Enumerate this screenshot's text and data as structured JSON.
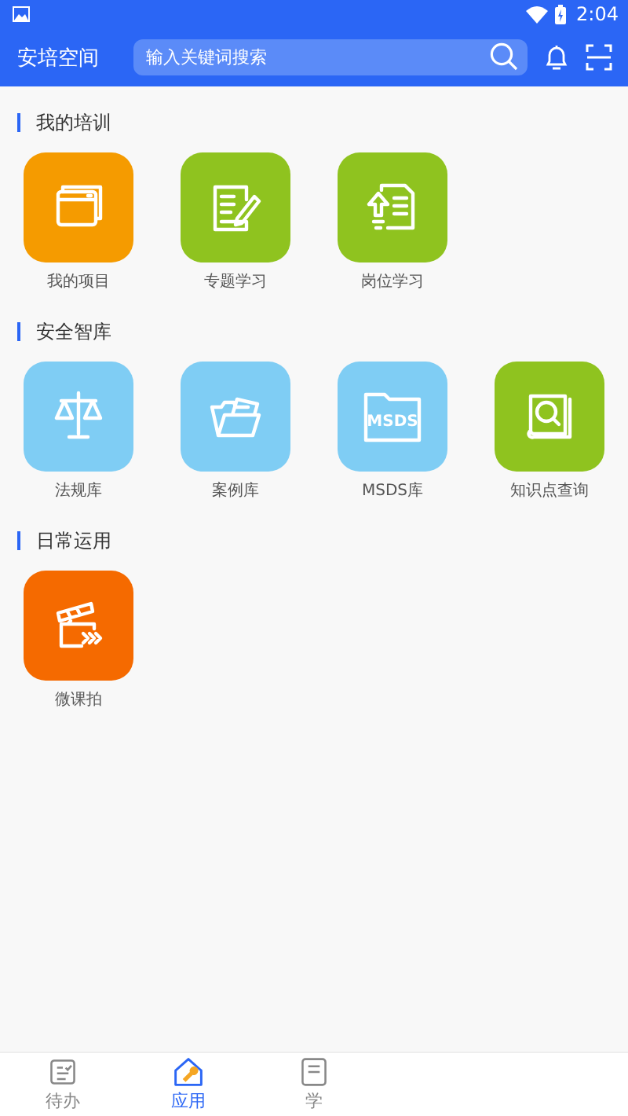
{
  "status_bar": {
    "time": "2:04"
  },
  "header": {
    "title": "安培空间",
    "search": {
      "placeholder": "输入关键词搜索"
    }
  },
  "sections": [
    {
      "title": "我的培训",
      "apps": [
        {
          "label": "我的项目",
          "color": "#f59b00"
        },
        {
          "label": "专题学习",
          "color": "#8fc31f"
        },
        {
          "label": "岗位学习",
          "color": "#8fc31f"
        }
      ]
    },
    {
      "title": "安全智库",
      "apps": [
        {
          "label": "法规库",
          "color": "#7fcdf4"
        },
        {
          "label": "案例库",
          "color": "#7fcdf4"
        },
        {
          "label": "MSDS库",
          "color": "#7fcdf4",
          "icon_text": "MSDS"
        },
        {
          "label": "知识点查询",
          "color": "#8fc31f"
        }
      ]
    },
    {
      "title": "日常运用",
      "apps": [
        {
          "label": "微课拍",
          "color": "#f56a00"
        }
      ]
    }
  ],
  "tabs": [
    {
      "label": "待办",
      "selected": false
    },
    {
      "label": "应用",
      "selected": true
    },
    {
      "label": "学",
      "selected": false
    }
  ]
}
